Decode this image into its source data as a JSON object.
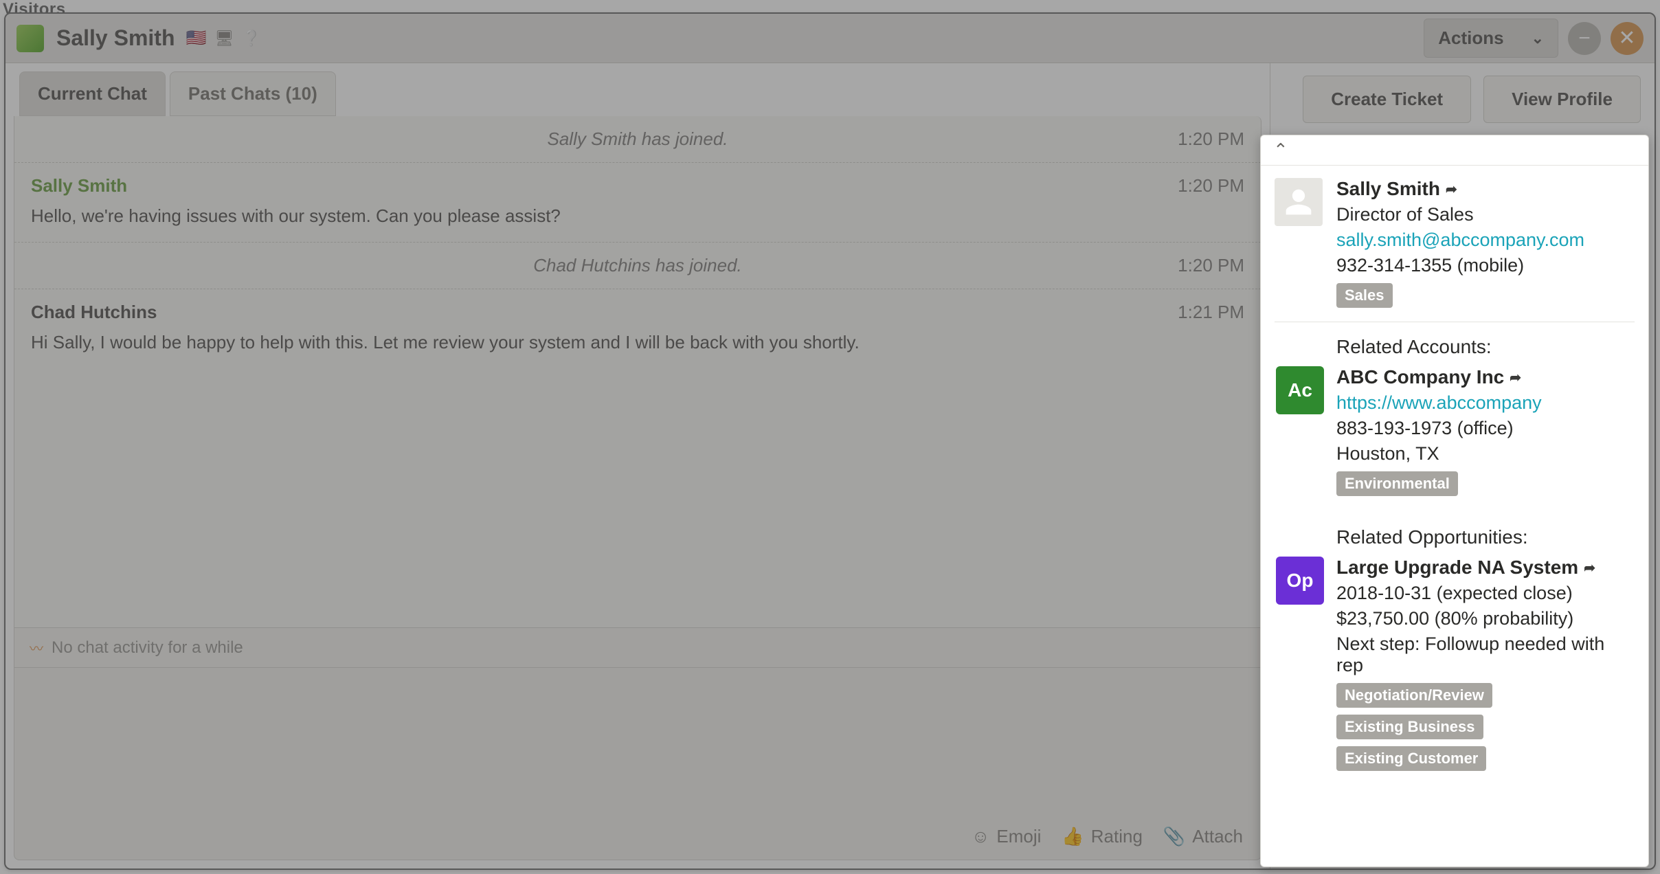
{
  "visitors_label": "Visitors",
  "topbar": {
    "title": "Sally Smith",
    "actions_label": "Actions"
  },
  "side_buttons": {
    "create_ticket": "Create Ticket",
    "view_profile": "View Profile"
  },
  "tabs": {
    "current": "Current Chat",
    "past": "Past Chats (10)"
  },
  "chat": {
    "events": [
      {
        "type": "system",
        "text": "Sally Smith has joined.",
        "time": "1:20 PM"
      },
      {
        "type": "message",
        "sender": "Sally Smith",
        "role": "customer",
        "body": "Hello, we're having issues with our system. Can you please assist?",
        "time": "1:20 PM"
      },
      {
        "type": "system",
        "text": "Chad Hutchins has joined.",
        "time": "1:20 PM"
      },
      {
        "type": "message",
        "sender": "Chad Hutchins",
        "role": "agent",
        "body": "Hi Sally, I would be happy to help with this. Let me review your system and I will be back with you shortly.",
        "time": "1:21 PM"
      }
    ],
    "inactivity": "No chat activity for a while"
  },
  "compose_tools": {
    "emoji": "Emoji",
    "rating": "Rating",
    "attach": "Attach"
  },
  "crm": {
    "contact": {
      "name": "Sally Smith",
      "title": "Director of Sales",
      "email": "sally.smith@abccompany.com",
      "phone": "932-314-1355 (mobile)",
      "tag": "Sales"
    },
    "accounts": {
      "heading": "Related Accounts:",
      "items": [
        {
          "badge": "Ac",
          "name": "ABC Company Inc",
          "url": "https://www.abccompany",
          "phone": "883-193-1973 (office)",
          "location": "Houston, TX",
          "tag": "Environmental"
        }
      ]
    },
    "opportunities": {
      "heading": "Related Opportunities:",
      "items": [
        {
          "badge": "Op",
          "name": "Large Upgrade NA System",
          "close": "2018-10-31 (expected close)",
          "amount": "$23,750.00 (80% probability)",
          "next": "Next step: Followup needed with rep",
          "tags": [
            "Negotiation/Review",
            "Existing Business",
            "Existing Customer"
          ]
        }
      ]
    }
  }
}
